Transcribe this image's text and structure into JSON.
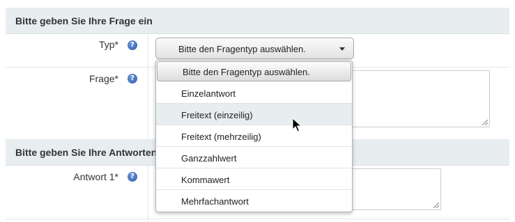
{
  "sections": {
    "question_header": "Bitte geben Sie Ihre Frage ein",
    "answers_header": "Bitte geben Sie Ihre Antworten ein"
  },
  "fields": {
    "type_label": "Typ*",
    "question_label": "Frage*",
    "answer1_label": "Antwort 1*"
  },
  "type_select": {
    "selected": "Bitte den Fragentyp auswählen."
  },
  "dropdown": {
    "options": [
      "Bitte den Fragentyp auswählen.",
      "Einzelantwort",
      "Freitext (einzeilig)",
      "Freitext (mehrzeilig)",
      "Ganzzahlwert",
      "Kommawert",
      "Mehrfachantwort"
    ],
    "hovered_index": 2
  },
  "icons": {
    "help": "help-icon",
    "help_glyph": "?",
    "cursor": "arrow-cursor-icon"
  },
  "colors": {
    "section_bg": "#e8edf0",
    "help_icon": "#2d5cb0",
    "hover_bg": "#e8edf0"
  }
}
